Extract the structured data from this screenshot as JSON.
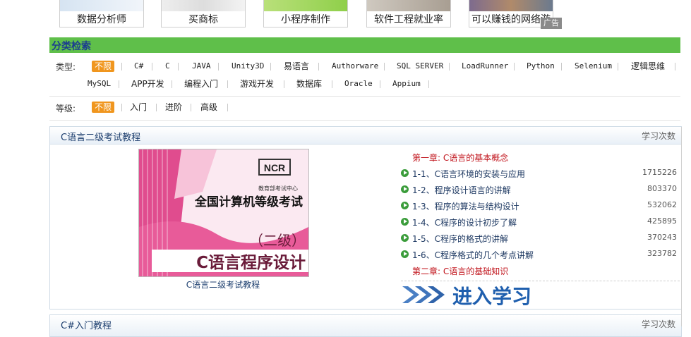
{
  "top_courses": [
    {
      "label": "数据分析师"
    },
    {
      "label": "买商标"
    },
    {
      "label": "小程序制作"
    },
    {
      "label": "软件工程就业率"
    },
    {
      "label": "可以赚钱的网络游"
    }
  ],
  "ad_badge": "广告",
  "category": {
    "title": "分类检索",
    "type_label": "类型:",
    "type_options": [
      "不限",
      "C#",
      "C",
      "JAVA",
      "Unity3D",
      "易语言",
      "Authorware",
      "SQL SERVER",
      "LoadRunner",
      "Python",
      "Selenium",
      "逻辑思维",
      "MySQL",
      "APP开发",
      "编程入门",
      "游戏开发",
      "数据库",
      "Oracle",
      "Appium"
    ],
    "level_label": "等级:",
    "level_options": [
      "不限",
      "入门",
      "进阶",
      "高级"
    ]
  },
  "course": {
    "title": "C语言二级考试教程",
    "count_header": "学习次数",
    "cover_caption": "C语言二级考试教程",
    "cover": {
      "publisher": "教育部考试中心",
      "headline": "全国计算机等级考试",
      "grade": "（二级）",
      "subject": "C语言程序设计",
      "logo": "NCR"
    },
    "chapter1": "第一章: C语言的基本概念",
    "lessons": [
      {
        "title": "1-1、C语言环境的安装与应用",
        "count": "1715226"
      },
      {
        "title": "1-2、程序设计语言的讲解",
        "count": "803370"
      },
      {
        "title": "1-3、程序的算法与结构设计",
        "count": "532062"
      },
      {
        "title": "1-4、C程序的设计初步了解",
        "count": "425895"
      },
      {
        "title": "1-5、C程序的格式的讲解",
        "count": "370243"
      },
      {
        "title": "1-6、C程序格式的几个考点讲解",
        "count": "323782"
      }
    ],
    "chapter2": "第二章: C语言的基础知识",
    "enter_label": "进入学习"
  },
  "course2": {
    "title": "C#入门教程",
    "count_header": "学习次数"
  },
  "colors": {
    "accent": "#f0961e",
    "header_green": "#5fbf4a",
    "chapter_red": "#c0121a",
    "link_blue": "#1f5fae"
  }
}
